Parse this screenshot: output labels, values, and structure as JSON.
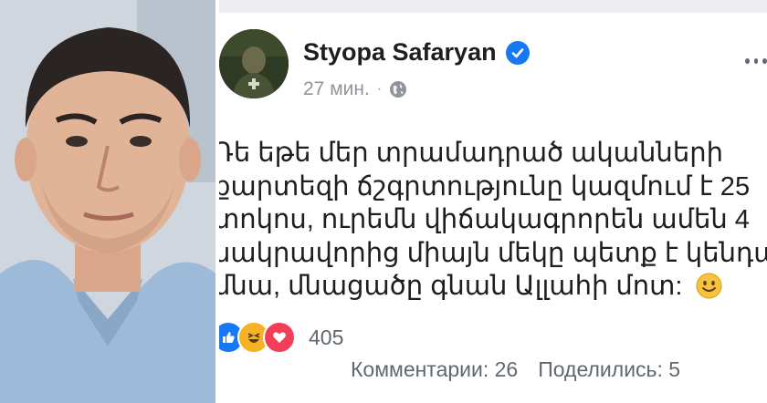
{
  "post": {
    "author": "Styopa Safaryan",
    "time": "27 мин.",
    "separator": "·",
    "privacy_icon": "globe-icon",
    "verified_icon": "verified-check-icon",
    "text_lines": [
      "Դե եթե մեր տրամադրած ականների",
      "քարտեզի ճշգրտությունը կազմում է 25",
      "տոկոս, ուրեմն վիճակագրորեն ամեն 4",
      "սակրավորից միայն մեկը պետք է կենդանի",
      "մնա, մնացածը գնան Ալլահի մոտ:"
    ],
    "reaction_icons": [
      "like-icon",
      "haha-icon",
      "love-icon"
    ],
    "reaction_count": "405",
    "comments": "Комментарии: 26",
    "shares": "Поделились: 5"
  },
  "colors": {
    "accent": "#1877f2",
    "text": "#1c1e21",
    "muted": "#90949c",
    "stat_text": "#606770"
  }
}
